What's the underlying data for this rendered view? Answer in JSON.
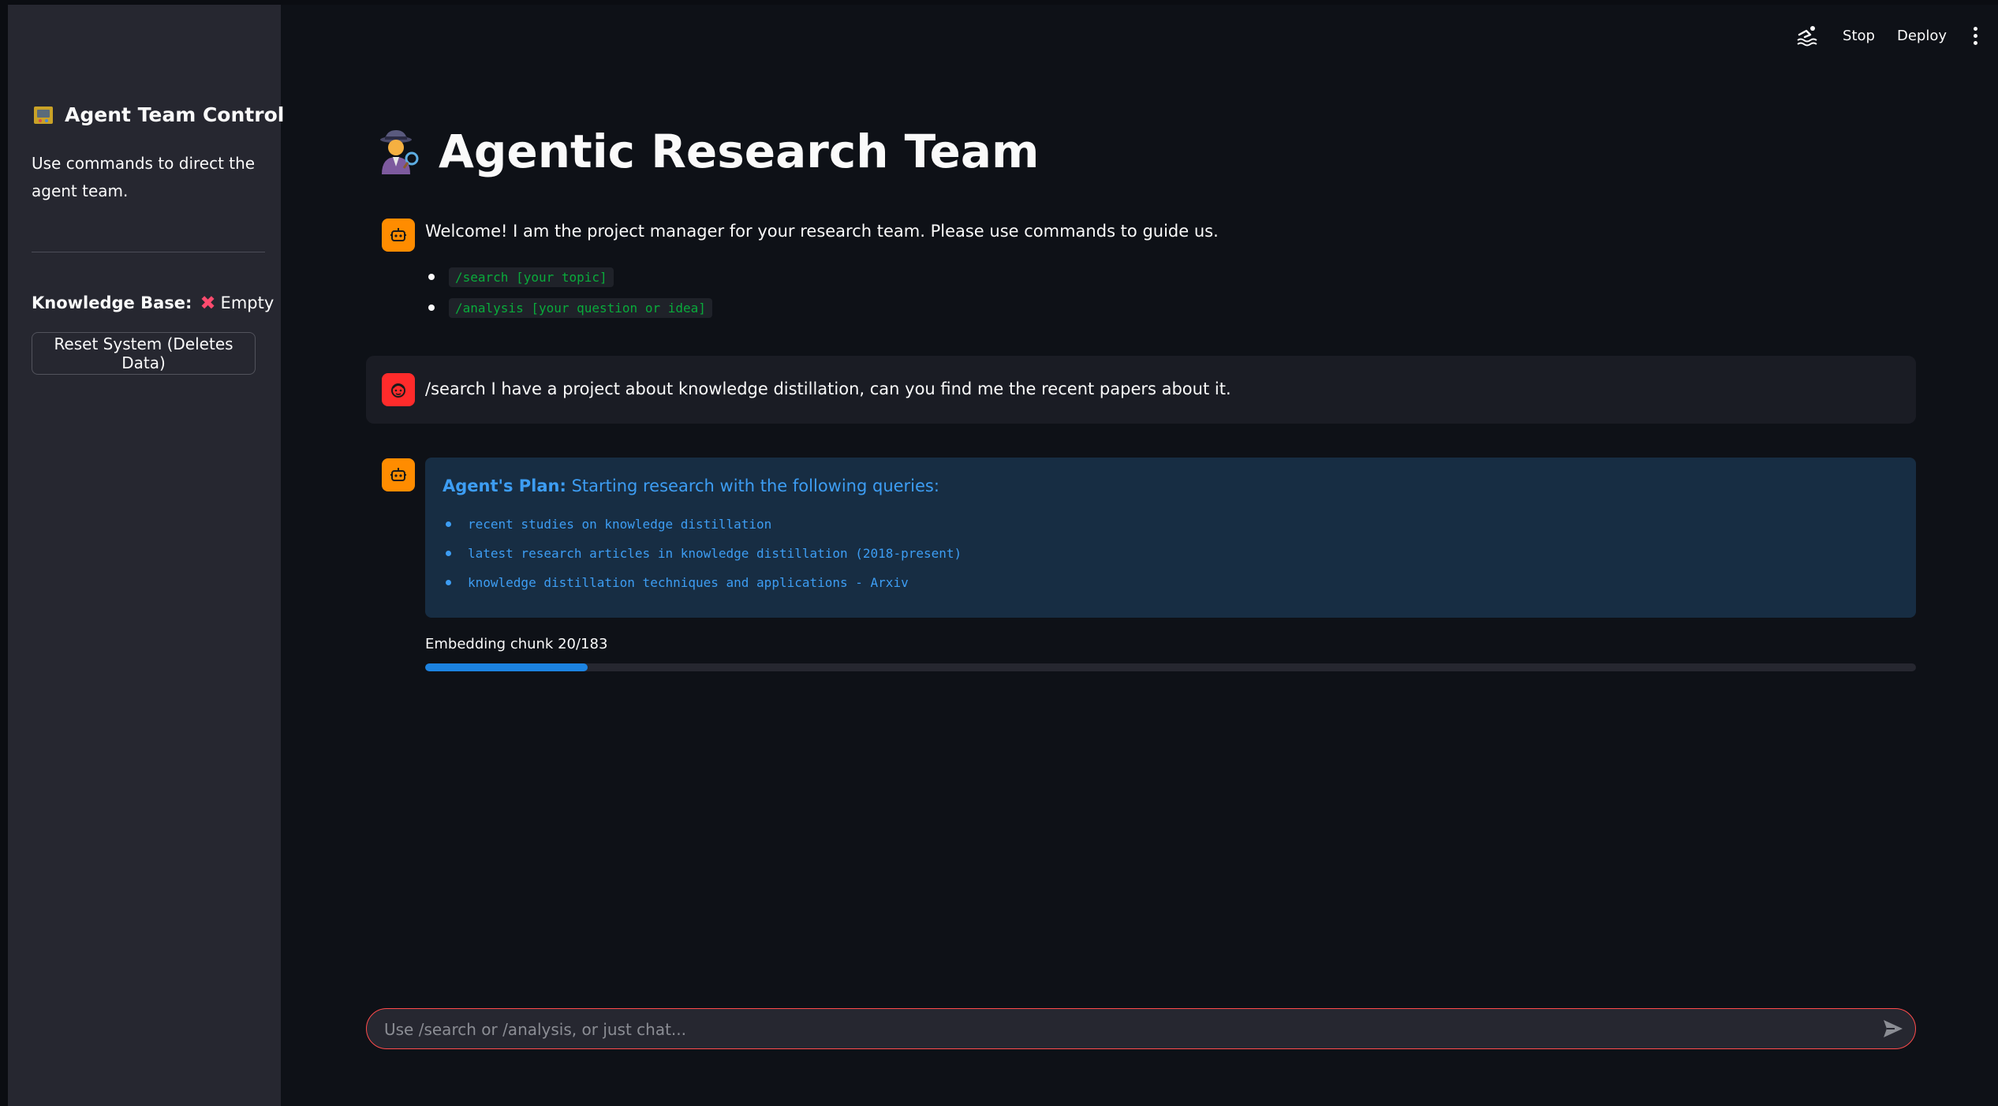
{
  "header": {
    "stop_label": "Stop",
    "deploy_label": "Deploy",
    "status_icon": "swimmer-icon",
    "menu_icon": "kebab-menu-icon"
  },
  "sidebar": {
    "title": "Agent Team Control",
    "title_icon": "control-panel-icon",
    "description": "Use commands to direct the agent team.",
    "knowledge_base_label": "Knowledge Base:",
    "knowledge_base_status": "Empty",
    "knowledge_base_status_icon": "cross-mark-icon",
    "reset_button_label": "Reset System (Deletes Data)"
  },
  "main": {
    "title": "Agentic Research Team",
    "title_icon": "detective-icon",
    "messages": [
      {
        "role": "assistant",
        "text": "Welcome! I am the project manager for your research team. Please use commands to guide us.",
        "commands": [
          "/search [your topic]",
          "/analysis [your question or idea]"
        ]
      },
      {
        "role": "user",
        "text": "/search I have a project about knowledge distillation, can you find me the recent papers about it."
      },
      {
        "role": "assistant",
        "plan_label": "Agent's Plan:",
        "plan_text": "Starting research with the following queries:",
        "queries": [
          "recent studies on knowledge distillation",
          "latest research articles in knowledge distillation (2018-present)",
          "knowledge distillation techniques and applications - Arxiv"
        ],
        "progress_label": "Embedding chunk 20/183",
        "progress_fraction": 0.109
      }
    ]
  },
  "chat_input": {
    "placeholder": "Use /search or /analysis, or just chat...",
    "value": ""
  },
  "colors": {
    "background": "#0e1117",
    "sidebar": "#262730",
    "assistant_avatar": "#ff8c00",
    "user_avatar": "#ff2b2b",
    "info_box": "#172d43",
    "info_text": "#3d9df3",
    "progress": "#1c83e1",
    "input_border": "#ff4b4b",
    "code_text": "#09ab3b"
  }
}
